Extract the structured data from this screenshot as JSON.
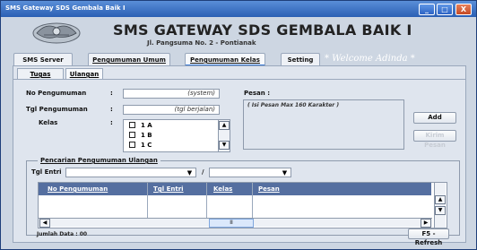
{
  "window": {
    "title": "SMS Gateway SDS Gembala Baik I",
    "controls": {
      "minimize": "_",
      "maximize": "□",
      "close": "X"
    }
  },
  "header": {
    "title": "SMS GATEWAY SDS GEMBALA BAIK I",
    "address": "Jl. Pangsuma No. 2 - Pontianak"
  },
  "main_tabs": [
    {
      "label": "SMS Server"
    },
    {
      "label": "Pengumuman Umum"
    },
    {
      "label": "Pengumuman Kelas"
    },
    {
      "label": "Setting"
    }
  ],
  "welcome_text": "* Welcome Adinda *",
  "sub_tabs": [
    {
      "label": "Tugas Harian"
    },
    {
      "label": "Ulangan"
    }
  ],
  "form": {
    "no_pengumuman_label": "No Pengumuman",
    "no_pengumuman_value": "(system)",
    "tgl_pengumuman_label": "Tgl Pengumuman",
    "tgl_pengumuman_value": "(tgl berjalan)",
    "kelas_label": "Kelas",
    "colon": ":",
    "kelas_items": [
      "1 A",
      "1 B",
      "1 C"
    ],
    "pesan_label": "Pesan :",
    "pesan_placeholder": "( Isi Pesan Max 160 Karakter )"
  },
  "buttons": {
    "add": "Add",
    "kirim": "Kirim Pesan",
    "refresh": "F5 - Refresh"
  },
  "search": {
    "legend": "Pencarian Pengumuman Ulangan",
    "tgl_entri_label": "Tgl Entri",
    "separator": "/"
  },
  "grid": {
    "columns": [
      "No Pengumuman",
      "Tgl  Entri",
      "Kelas",
      "Pesan"
    ],
    "rows": []
  },
  "scroll": {
    "up": "▲",
    "down": "▼",
    "left": "◀",
    "right": "▶",
    "thumb": "II"
  },
  "footer": {
    "jumlah_data": "Jumlah Data : 00"
  }
}
